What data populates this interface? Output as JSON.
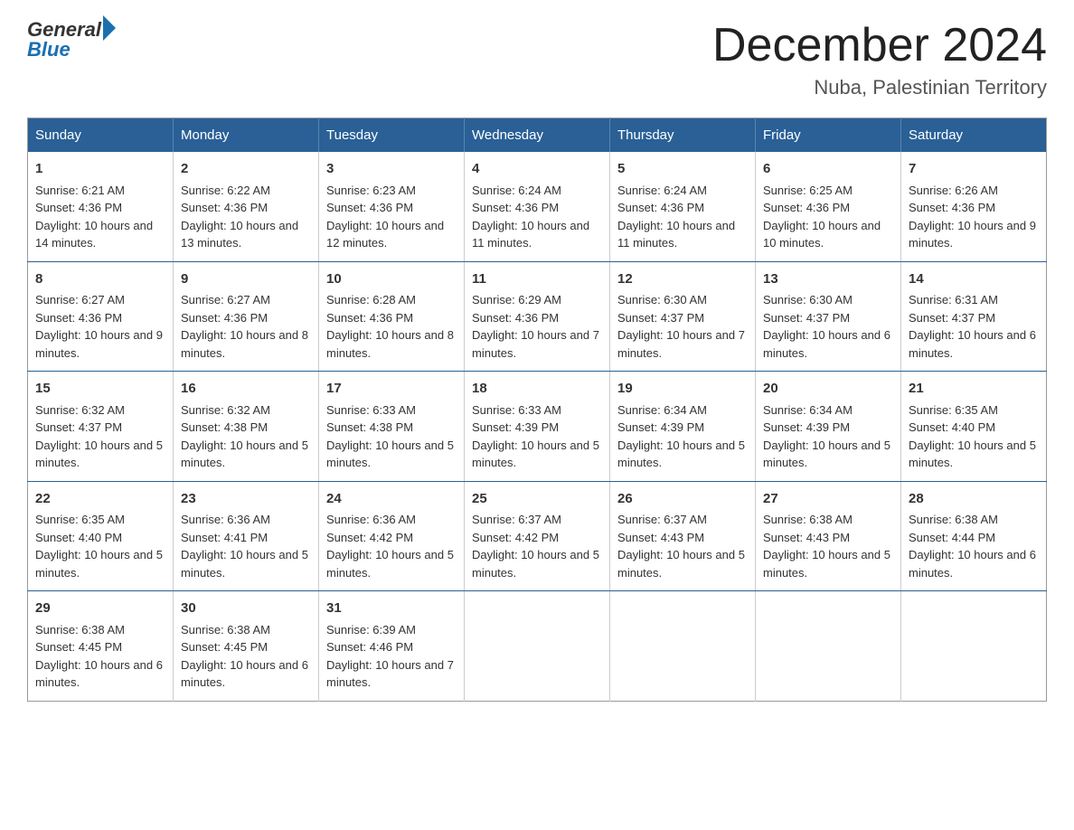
{
  "logo": {
    "general": "General",
    "blue": "Blue"
  },
  "title": {
    "month": "December 2024",
    "location": "Nuba, Palestinian Territory"
  },
  "weekdays": [
    "Sunday",
    "Monday",
    "Tuesday",
    "Wednesday",
    "Thursday",
    "Friday",
    "Saturday"
  ],
  "weeks": [
    [
      {
        "day": "1",
        "sunrise": "6:21 AM",
        "sunset": "4:36 PM",
        "daylight": "10 hours and 14 minutes."
      },
      {
        "day": "2",
        "sunrise": "6:22 AM",
        "sunset": "4:36 PM",
        "daylight": "10 hours and 13 minutes."
      },
      {
        "day": "3",
        "sunrise": "6:23 AM",
        "sunset": "4:36 PM",
        "daylight": "10 hours and 12 minutes."
      },
      {
        "day": "4",
        "sunrise": "6:24 AM",
        "sunset": "4:36 PM",
        "daylight": "10 hours and 11 minutes."
      },
      {
        "day": "5",
        "sunrise": "6:24 AM",
        "sunset": "4:36 PM",
        "daylight": "10 hours and 11 minutes."
      },
      {
        "day": "6",
        "sunrise": "6:25 AM",
        "sunset": "4:36 PM",
        "daylight": "10 hours and 10 minutes."
      },
      {
        "day": "7",
        "sunrise": "6:26 AM",
        "sunset": "4:36 PM",
        "daylight": "10 hours and 9 minutes."
      }
    ],
    [
      {
        "day": "8",
        "sunrise": "6:27 AM",
        "sunset": "4:36 PM",
        "daylight": "10 hours and 9 minutes."
      },
      {
        "day": "9",
        "sunrise": "6:27 AM",
        "sunset": "4:36 PM",
        "daylight": "10 hours and 8 minutes."
      },
      {
        "day": "10",
        "sunrise": "6:28 AM",
        "sunset": "4:36 PM",
        "daylight": "10 hours and 8 minutes."
      },
      {
        "day": "11",
        "sunrise": "6:29 AM",
        "sunset": "4:36 PM",
        "daylight": "10 hours and 7 minutes."
      },
      {
        "day": "12",
        "sunrise": "6:30 AM",
        "sunset": "4:37 PM",
        "daylight": "10 hours and 7 minutes."
      },
      {
        "day": "13",
        "sunrise": "6:30 AM",
        "sunset": "4:37 PM",
        "daylight": "10 hours and 6 minutes."
      },
      {
        "day": "14",
        "sunrise": "6:31 AM",
        "sunset": "4:37 PM",
        "daylight": "10 hours and 6 minutes."
      }
    ],
    [
      {
        "day": "15",
        "sunrise": "6:32 AM",
        "sunset": "4:37 PM",
        "daylight": "10 hours and 5 minutes."
      },
      {
        "day": "16",
        "sunrise": "6:32 AM",
        "sunset": "4:38 PM",
        "daylight": "10 hours and 5 minutes."
      },
      {
        "day": "17",
        "sunrise": "6:33 AM",
        "sunset": "4:38 PM",
        "daylight": "10 hours and 5 minutes."
      },
      {
        "day": "18",
        "sunrise": "6:33 AM",
        "sunset": "4:39 PM",
        "daylight": "10 hours and 5 minutes."
      },
      {
        "day": "19",
        "sunrise": "6:34 AM",
        "sunset": "4:39 PM",
        "daylight": "10 hours and 5 minutes."
      },
      {
        "day": "20",
        "sunrise": "6:34 AM",
        "sunset": "4:39 PM",
        "daylight": "10 hours and 5 minutes."
      },
      {
        "day": "21",
        "sunrise": "6:35 AM",
        "sunset": "4:40 PM",
        "daylight": "10 hours and 5 minutes."
      }
    ],
    [
      {
        "day": "22",
        "sunrise": "6:35 AM",
        "sunset": "4:40 PM",
        "daylight": "10 hours and 5 minutes."
      },
      {
        "day": "23",
        "sunrise": "6:36 AM",
        "sunset": "4:41 PM",
        "daylight": "10 hours and 5 minutes."
      },
      {
        "day": "24",
        "sunrise": "6:36 AM",
        "sunset": "4:42 PM",
        "daylight": "10 hours and 5 minutes."
      },
      {
        "day": "25",
        "sunrise": "6:37 AM",
        "sunset": "4:42 PM",
        "daylight": "10 hours and 5 minutes."
      },
      {
        "day": "26",
        "sunrise": "6:37 AM",
        "sunset": "4:43 PM",
        "daylight": "10 hours and 5 minutes."
      },
      {
        "day": "27",
        "sunrise": "6:38 AM",
        "sunset": "4:43 PM",
        "daylight": "10 hours and 5 minutes."
      },
      {
        "day": "28",
        "sunrise": "6:38 AM",
        "sunset": "4:44 PM",
        "daylight": "10 hours and 6 minutes."
      }
    ],
    [
      {
        "day": "29",
        "sunrise": "6:38 AM",
        "sunset": "4:45 PM",
        "daylight": "10 hours and 6 minutes."
      },
      {
        "day": "30",
        "sunrise": "6:38 AM",
        "sunset": "4:45 PM",
        "daylight": "10 hours and 6 minutes."
      },
      {
        "day": "31",
        "sunrise": "6:39 AM",
        "sunset": "4:46 PM",
        "daylight": "10 hours and 7 minutes."
      },
      null,
      null,
      null,
      null
    ]
  ]
}
